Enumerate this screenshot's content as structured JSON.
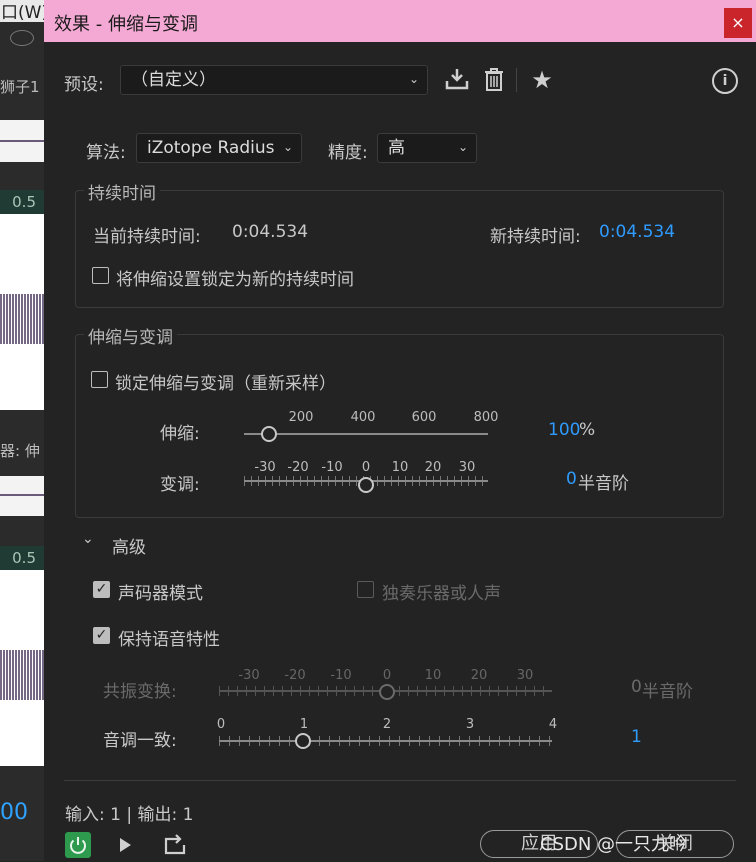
{
  "background": {
    "menu_fragment": "口(W)",
    "tab1_fragment": "狮子1",
    "tab2_fragment": "器: 伸",
    "ruler_label": "0.5",
    "time_fragment": "00"
  },
  "dialog": {
    "title": "效果 - 伸缩与变调",
    "close_glyph": "×",
    "preset": {
      "label": "预设:",
      "value": "（自定义）"
    },
    "algorithm": {
      "label": "算法:",
      "value": "iZotope Radius"
    },
    "precision": {
      "label": "精度:",
      "value": "高"
    },
    "duration": {
      "title": "持续时间",
      "current_label": "当前持续时间:",
      "current_value": "0:04.534",
      "new_label": "新持续时间:",
      "new_value": "0:04.534",
      "lock_label": "将伸缩设置锁定为新的持续时间"
    },
    "stretch_pitch": {
      "title": "伸缩与变调",
      "lock_label": "锁定伸缩与变调（重新采样）",
      "stretch_label": "伸缩:",
      "stretch_ticks": [
        "200",
        "400",
        "600",
        "800"
      ],
      "stretch_value": "100",
      "stretch_unit": "%",
      "pitch_label": "变调:",
      "pitch_ticks": [
        "-30",
        "-20",
        "-10",
        "0",
        "10",
        "20",
        "30"
      ],
      "pitch_value": "0",
      "pitch_unit": "半音阶"
    },
    "advanced": {
      "label": "高级",
      "vocoder_label": "声码器模式",
      "solo_label": "独奏乐器或人声",
      "preserve_label": "保持语音特性",
      "formant_label": "共振变换:",
      "formant_ticks": [
        "-30",
        "-20",
        "-10",
        "0",
        "10",
        "20",
        "30"
      ],
      "formant_value": "0",
      "formant_unit": "半音阶",
      "coherence_label": "音调一致:",
      "coherence_ticks": [
        "0",
        "1",
        "2",
        "3",
        "4"
      ],
      "coherence_value": "1"
    },
    "io_text": "输入: 1 | 输出: 1",
    "apply_label": "应用",
    "close_label": "关闭",
    "watermark": "CSDN @一只九吟"
  },
  "colors": {
    "titlebar": "#f4a9d4",
    "accent_blue": "#2f9bff",
    "close_red": "#c9252b",
    "power_green": "#2e9a4e"
  }
}
